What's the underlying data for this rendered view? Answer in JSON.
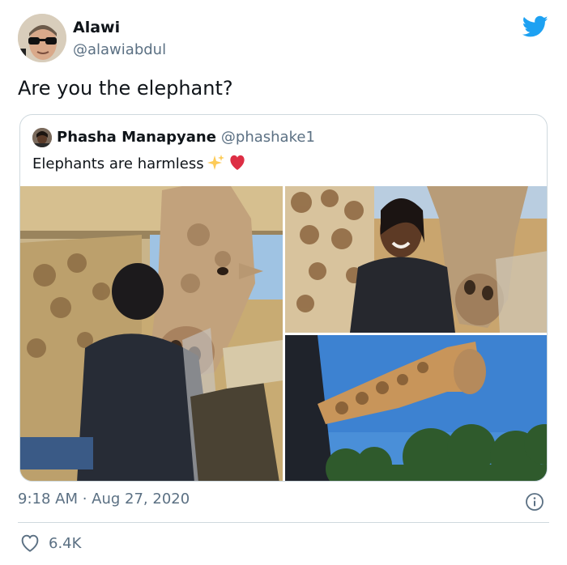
{
  "tweet": {
    "author_name": "Alawi",
    "author_handle": "@alawiabdul",
    "text": "Are you the elephant?",
    "timestamp": "9:18 AM · Aug 27, 2020",
    "like_count": "6.4K"
  },
  "quoted": {
    "author_name": "Phasha Manapyane",
    "author_handle": "@phashake1",
    "text": "Elephants are harmless"
  },
  "icons": {
    "brand": "twitter-bird-icon",
    "info": "info-icon",
    "like": "heart-outline-icon",
    "emoji": [
      "sparkles-emoji",
      "red-heart-emoji"
    ]
  },
  "colors": {
    "brand": "#1da1f2",
    "secondary_text": "#5b7083",
    "border": "#cfd9de"
  }
}
